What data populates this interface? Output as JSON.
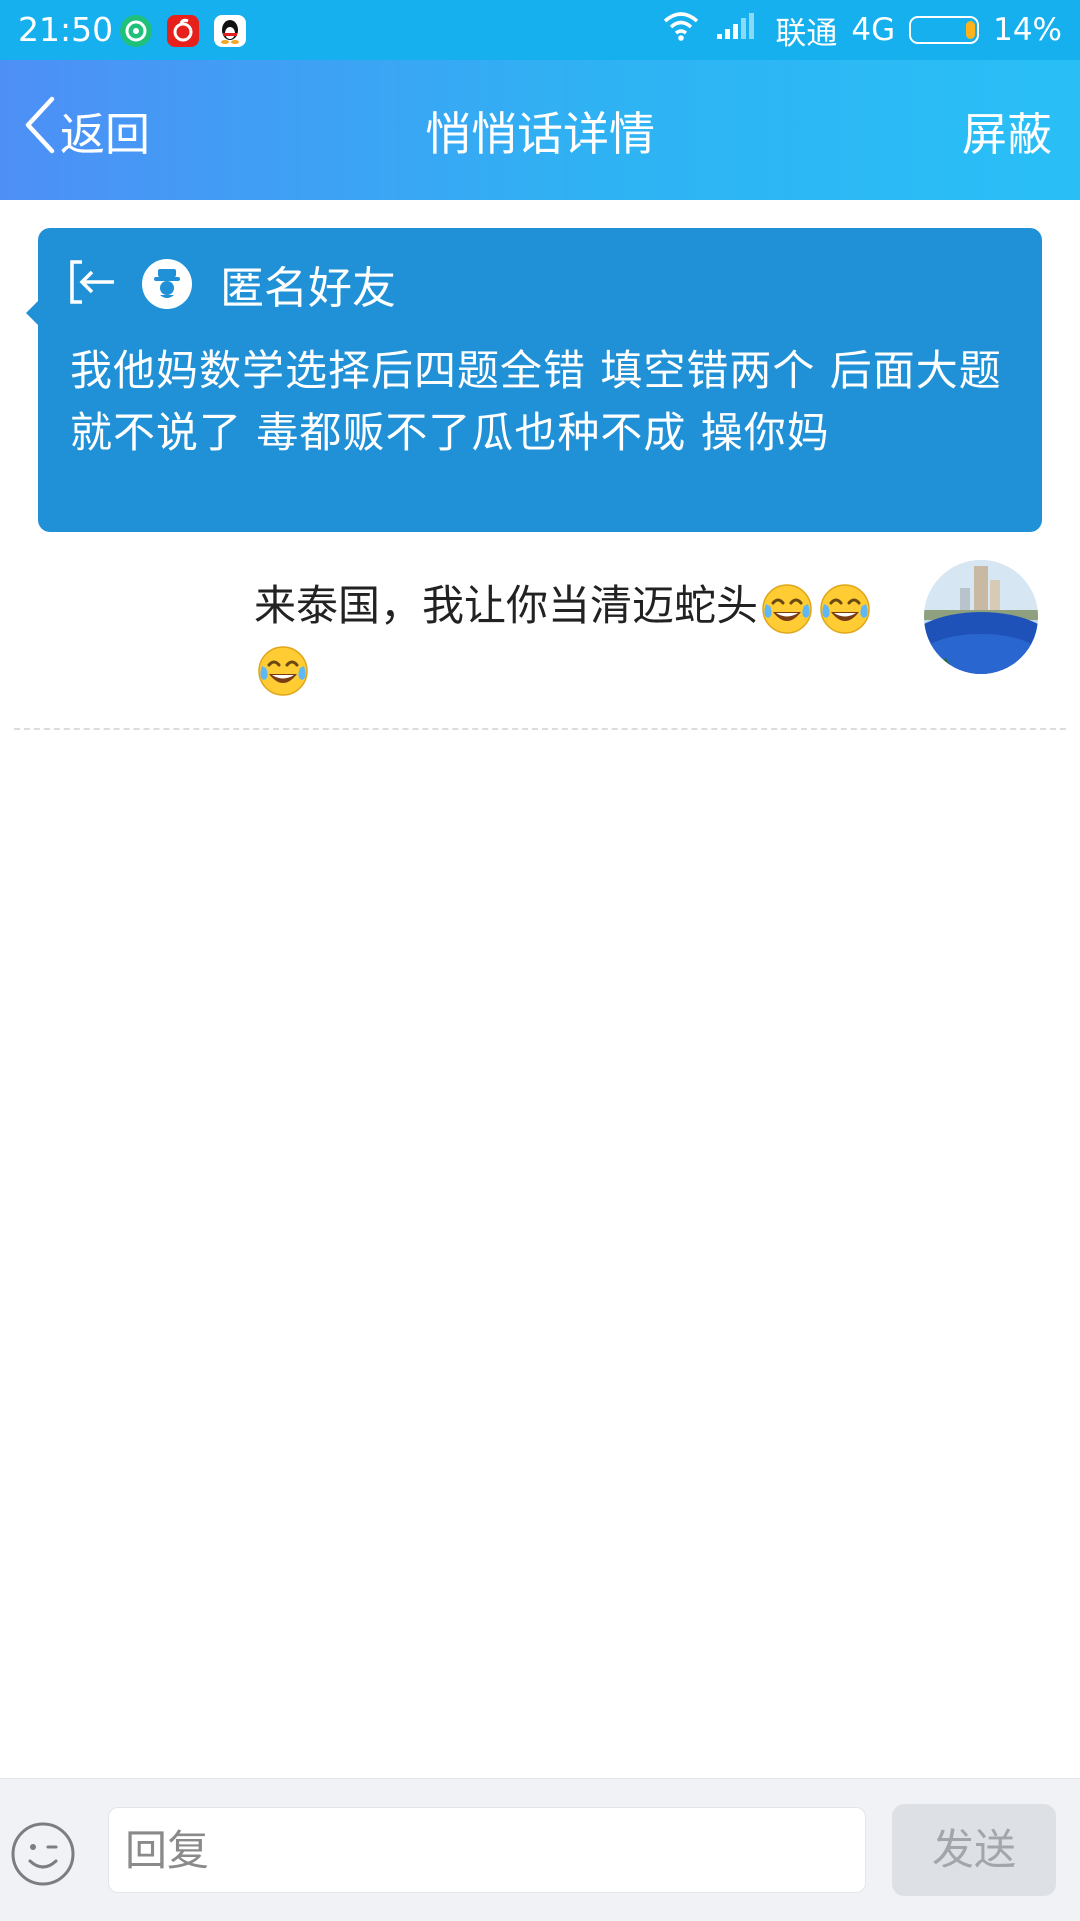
{
  "status_bar": {
    "time": "21:50",
    "apps": [
      "moments-app-icon",
      "netease-music-icon",
      "qq-penguin-icon"
    ],
    "carrier": "联通",
    "network": "4G",
    "battery": "14%",
    "battery_level": 0.14
  },
  "nav": {
    "back_label": "返回",
    "title": "悄悄话详情",
    "block_label": "屏蔽"
  },
  "whisper": {
    "sender": "匿名好友",
    "message": "我他妈数学选择后四题全错 填空错两个 后面大题就不说了 毒都贩不了瓜也种不成 操你妈"
  },
  "reply": {
    "text": "来泰国，我让你当清迈蛇头",
    "emoji": "tears-of-joy-emoji",
    "emoji_count": 3
  },
  "input": {
    "placeholder": "回复",
    "send_label": "发送"
  },
  "colors": {
    "status_bar": "#16b0ee",
    "nav_start": "#4e8ff6",
    "nav_end": "#29bff6",
    "whisper_card": "#2091d6",
    "send_disabled_bg": "#dde1e6",
    "send_disabled_text": "#a2a6ab"
  }
}
